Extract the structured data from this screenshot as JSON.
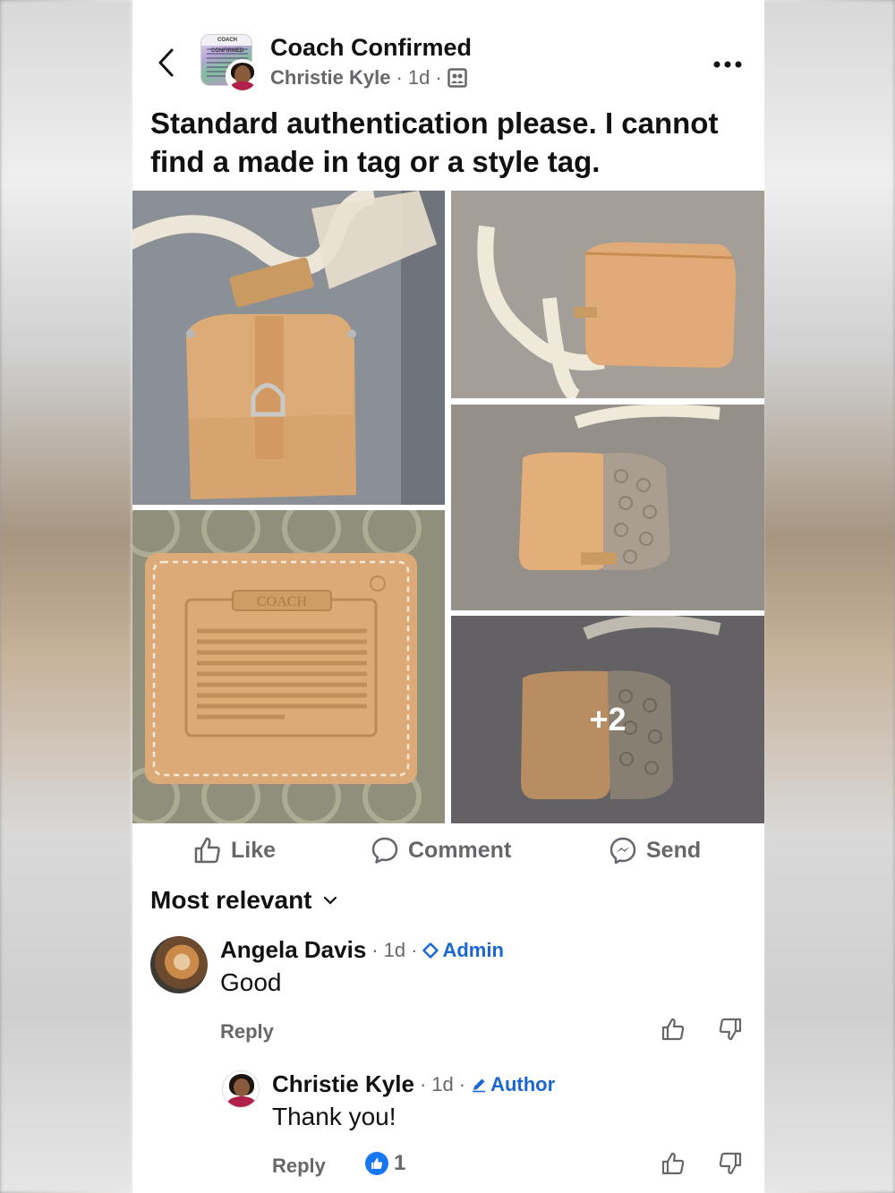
{
  "post": {
    "group_name": "Coach Confirmed",
    "group_avatar_text": "COACH CONFIRMED",
    "author": "Christie Kyle",
    "time": "1d",
    "sep": "·",
    "text": "Standard authentication please.  I cannot find a made in tag or a style tag.",
    "more_photos": "+2",
    "creed_patch_title": "COACH"
  },
  "actions": {
    "like": "Like",
    "comment": "Comment",
    "send": "Send"
  },
  "sort": {
    "label": "Most relevant"
  },
  "comments": [
    {
      "name": "Angela Davis",
      "time": "1d",
      "badge": "Admin",
      "text": "Good",
      "reply": "Reply"
    },
    {
      "name": "Christie Kyle",
      "time": "1d",
      "badge": "Author",
      "text": "Thank you!",
      "reply": "Reply",
      "like_count": "1"
    }
  ],
  "colors": {
    "link_blue": "#1b67d2",
    "like_blue": "#1877f2",
    "secondary_text": "#65676b",
    "leather": "#d8a774"
  }
}
